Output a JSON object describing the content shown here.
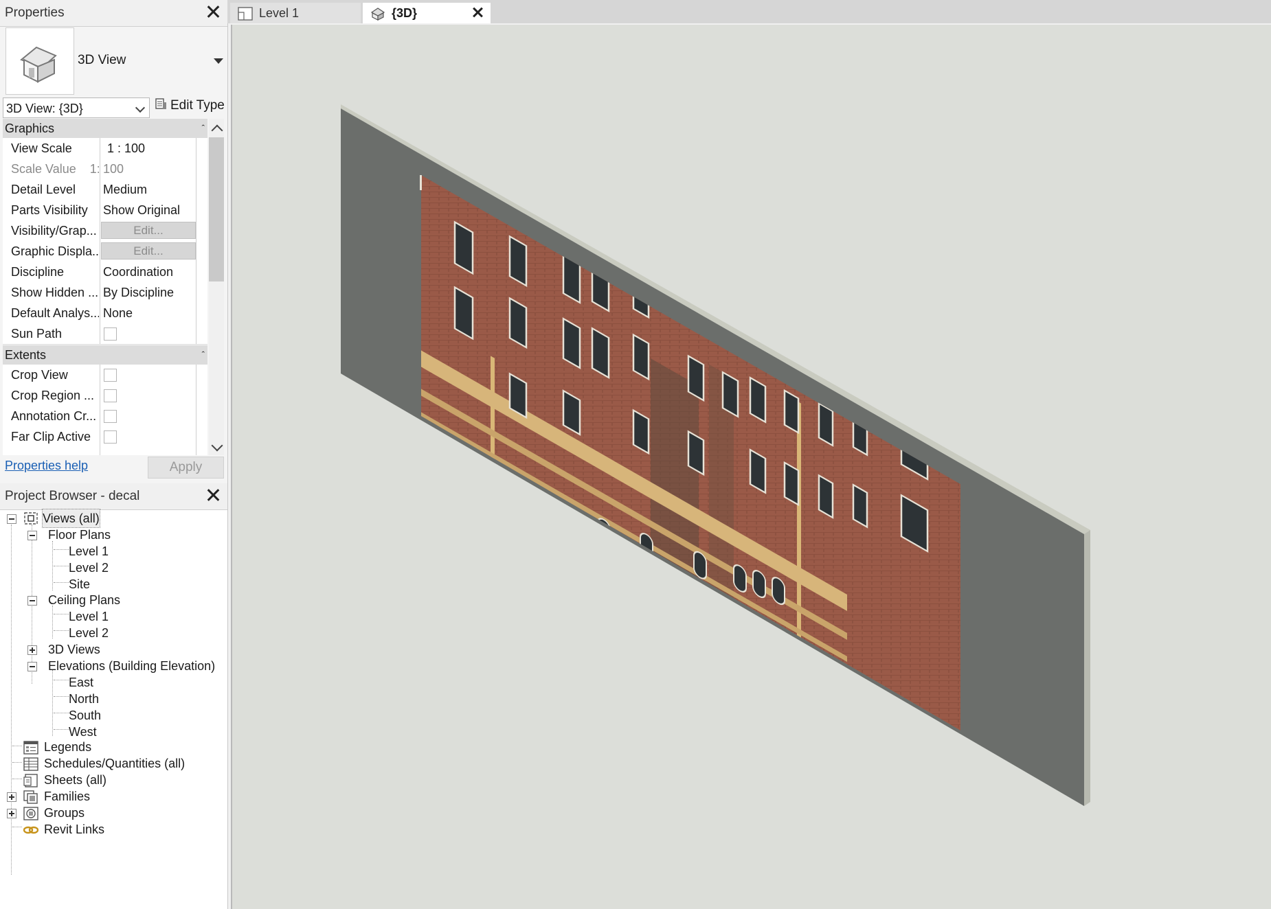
{
  "properties": {
    "title": "Properties",
    "type_name": "3D View",
    "view_selector": "3D View: {3D}",
    "edit_type_label": "Edit Type",
    "groups": {
      "graphics": "Graphics",
      "extents": "Extents"
    },
    "rows": {
      "view_scale": {
        "key": "View Scale",
        "value": "1 : 100"
      },
      "scale_value": {
        "key": "Scale Value    1:",
        "value": "100"
      },
      "detail_level": {
        "key": "Detail Level",
        "value": "Medium"
      },
      "parts_visibility": {
        "key": "Parts Visibility",
        "value": "Show Original"
      },
      "visibility_graphics": {
        "key": "Visibility/Grap...",
        "value": "Edit..."
      },
      "graphic_display": {
        "key": "Graphic Displa...",
        "value": "Edit..."
      },
      "discipline": {
        "key": "Discipline",
        "value": "Coordination"
      },
      "show_hidden": {
        "key": "Show Hidden ...",
        "value": "By Discipline"
      },
      "default_analysis": {
        "key": "Default Analys...",
        "value": "None"
      },
      "sun_path": {
        "key": "Sun Path",
        "checked": false
      },
      "crop_view": {
        "key": "Crop View",
        "checked": false
      },
      "crop_region": {
        "key": "Crop Region ...",
        "checked": false
      },
      "annotation_crop": {
        "key": "Annotation Cr...",
        "checked": false
      },
      "far_clip_active": {
        "key": "Far Clip Active",
        "checked": false
      }
    },
    "help_link": "Properties help",
    "apply_label": "Apply"
  },
  "project_browser": {
    "title": "Project Browser - decal",
    "views_all": "Views (all)",
    "floor_plans": "Floor Plans",
    "floor_level_1": "Level 1",
    "floor_level_2": "Level 2",
    "floor_site": "Site",
    "ceiling_plans": "Ceiling Plans",
    "ceiling_level_1": "Level 1",
    "ceiling_level_2": "Level 2",
    "views_3d": "3D Views",
    "elevations": "Elevations (Building Elevation)",
    "east": "East",
    "north": "North",
    "south": "South",
    "west": "West",
    "legends": "Legends",
    "schedules": "Schedules/Quantities (all)",
    "sheets": "Sheets (all)",
    "families": "Families",
    "groups": "Groups",
    "revit_links": "Revit Links"
  },
  "tabs": {
    "level1": "Level 1",
    "view3d": "{3D}"
  },
  "colors": {
    "wall": "#6b6e6b",
    "wall_top": "#c9cbc0",
    "viewport_bg": "#dcded9",
    "brick": "#9a5a48"
  }
}
